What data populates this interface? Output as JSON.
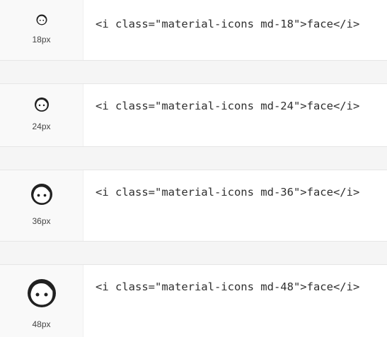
{
  "rows": [
    {
      "icon": "face-icon",
      "size_label": "18px",
      "code": "<i class=\"material-icons md-18\">face</i>"
    },
    {
      "icon": "face-icon",
      "size_label": "24px",
      "code": "<i class=\"material-icons md-24\">face</i>"
    },
    {
      "icon": "face-icon",
      "size_label": "36px",
      "code": "<i class=\"material-icons md-36\">face</i>"
    },
    {
      "icon": "face-icon",
      "size_label": "48px",
      "code": "<i class=\"material-icons md-48\">face</i>"
    }
  ],
  "colors": {
    "icon": "#212121",
    "code_text": "#2f2f2f",
    "label_text": "#444444",
    "icon_cell_bg": "#f9f9f9",
    "code_cell_bg": "#ffffff",
    "gap_bg": "#f5f5f5"
  }
}
